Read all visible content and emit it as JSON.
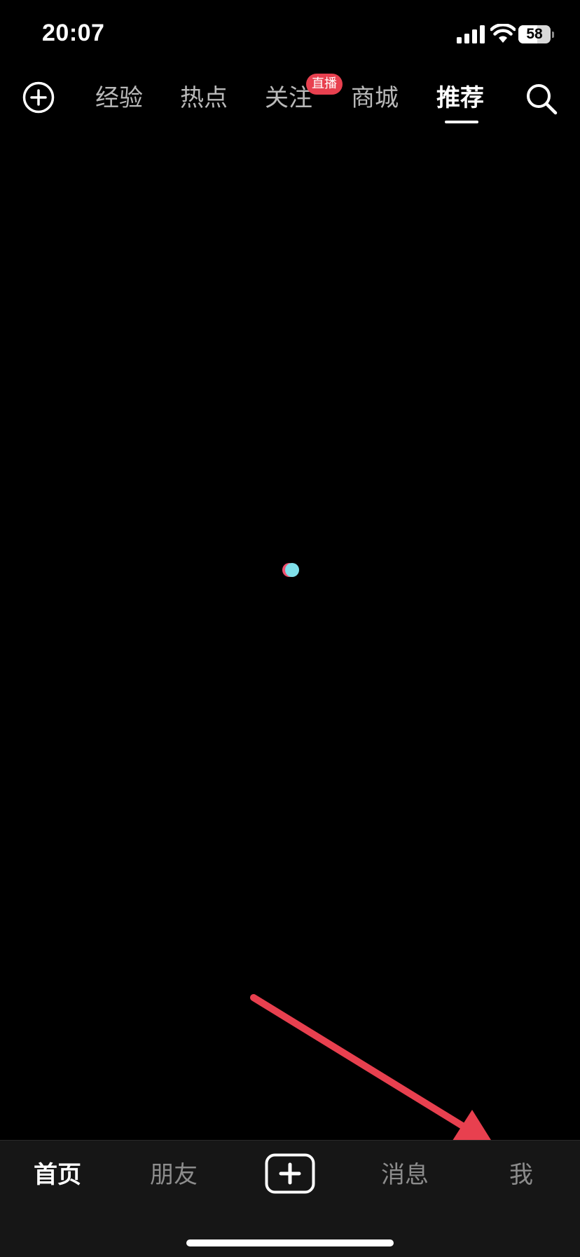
{
  "status_bar": {
    "time": "20:07",
    "battery_level": "58",
    "icons": [
      "signal-icon",
      "wifi-icon",
      "battery-icon"
    ]
  },
  "top_nav": {
    "tabs": [
      {
        "label": "经验"
      },
      {
        "label": "热点"
      },
      {
        "label": "关注",
        "badge": "直播"
      },
      {
        "label": "商城"
      },
      {
        "label": "推荐",
        "active": true
      }
    ],
    "left_icon": "plus-circle-icon",
    "right_icon": "search-icon"
  },
  "content": {
    "loader_icon": "loading-dot-icon"
  },
  "bottom_nav": {
    "tabs": [
      {
        "label": "首页",
        "active": true
      },
      {
        "label": "朋友"
      },
      {
        "label": "消息"
      },
      {
        "label": "我"
      }
    ],
    "create_icon": "plus-square-icon"
  },
  "annotation": {
    "type": "arrow",
    "color": "#e8404f"
  },
  "colors": {
    "background": "#000000",
    "accent": "#e8404f",
    "bottom_bar": "#161616",
    "inactive_text": "#b9b9b9"
  }
}
